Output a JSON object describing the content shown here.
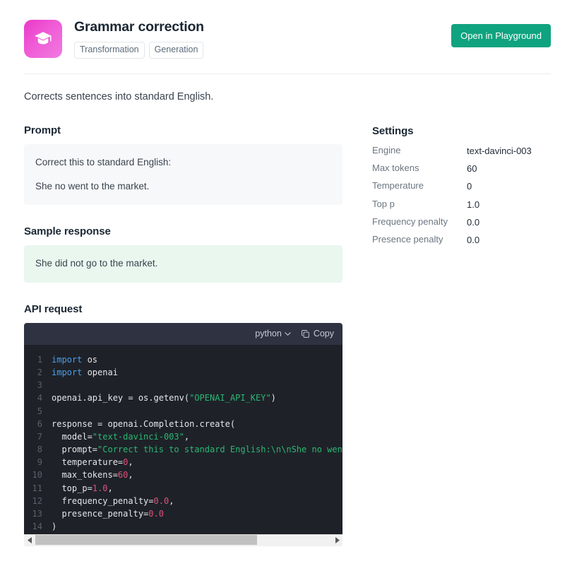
{
  "header": {
    "icon_name": "graduation-cap-icon",
    "title": "Grammar correction",
    "tags": [
      "Transformation",
      "Generation"
    ],
    "playground_button": "Open in Playground",
    "accent_color": "#10a37f",
    "icon_gradient_from": "#e838c8",
    "icon_gradient_to": "#f07ae0"
  },
  "description": "Corrects sentences into standard English.",
  "prompt": {
    "title": "Prompt",
    "lines": [
      "Correct this to standard English:",
      "She no went to the market."
    ]
  },
  "sample_response": {
    "title": "Sample response",
    "text": "She did not go to the market."
  },
  "api_request": {
    "title": "API request",
    "language": "python",
    "copy_label": "Copy",
    "chevron_icon": "chevron-down-icon",
    "copy_icon": "copy-icon",
    "code_lines": [
      {
        "n": "1",
        "tokens": [
          {
            "t": "import",
            "c": "kw"
          },
          {
            "t": " os",
            "c": "cd"
          }
        ]
      },
      {
        "n": "2",
        "tokens": [
          {
            "t": "import",
            "c": "kw"
          },
          {
            "t": " openai",
            "c": "cd"
          }
        ]
      },
      {
        "n": "3",
        "tokens": []
      },
      {
        "n": "4",
        "tokens": [
          {
            "t": "openai.api_key = os.getenv(",
            "c": "cd"
          },
          {
            "t": "\"OPENAI_API_KEY\"",
            "c": "str"
          },
          {
            "t": ")",
            "c": "cd"
          }
        ]
      },
      {
        "n": "5",
        "tokens": []
      },
      {
        "n": "6",
        "tokens": [
          {
            "t": "response = openai.Completion.create(",
            "c": "cd"
          }
        ]
      },
      {
        "n": "7",
        "tokens": [
          {
            "t": "  model=",
            "c": "cd"
          },
          {
            "t": "\"text-davinci-003\"",
            "c": "str"
          },
          {
            "t": ",",
            "c": "cd"
          }
        ]
      },
      {
        "n": "8",
        "tokens": [
          {
            "t": "  prompt=",
            "c": "cd"
          },
          {
            "t": "\"Correct this to standard English:\\n\\nShe no went to the market.\"",
            "c": "str"
          },
          {
            "t": ",",
            "c": "cd"
          }
        ]
      },
      {
        "n": "9",
        "tokens": [
          {
            "t": "  temperature=",
            "c": "cd"
          },
          {
            "t": "0",
            "c": "num"
          },
          {
            "t": ",",
            "c": "cd"
          }
        ]
      },
      {
        "n": "10",
        "tokens": [
          {
            "t": "  max_tokens=",
            "c": "cd"
          },
          {
            "t": "60",
            "c": "num"
          },
          {
            "t": ",",
            "c": "cd"
          }
        ]
      },
      {
        "n": "11",
        "tokens": [
          {
            "t": "  top_p=",
            "c": "cd"
          },
          {
            "t": "1.0",
            "c": "num"
          },
          {
            "t": ",",
            "c": "cd"
          }
        ]
      },
      {
        "n": "12",
        "tokens": [
          {
            "t": "  frequency_penalty=",
            "c": "cd"
          },
          {
            "t": "0.0",
            "c": "num"
          },
          {
            "t": ",",
            "c": "cd"
          }
        ]
      },
      {
        "n": "13",
        "tokens": [
          {
            "t": "  presence_penalty=",
            "c": "cd"
          },
          {
            "t": "0.0",
            "c": "num"
          }
        ]
      },
      {
        "n": "14",
        "tokens": [
          {
            "t": ")",
            "c": "cd"
          }
        ]
      }
    ],
    "scroll_thumb_percent": 75
  },
  "settings": {
    "title": "Settings",
    "rows": [
      {
        "key": "Engine",
        "value": "text-davinci-003"
      },
      {
        "key": "Max tokens",
        "value": "60"
      },
      {
        "key": "Temperature",
        "value": "0"
      },
      {
        "key": "Top p",
        "value": "1.0"
      },
      {
        "key": "Frequency penalty",
        "value": "0.0"
      },
      {
        "key": "Presence penalty",
        "value": "0.0"
      }
    ]
  }
}
